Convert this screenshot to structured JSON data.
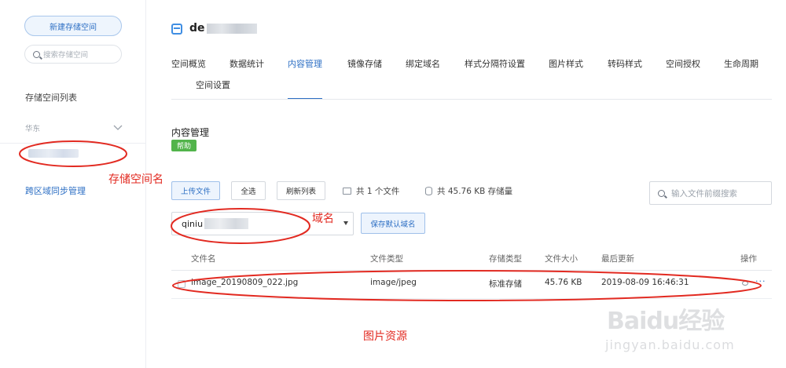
{
  "sidebar": {
    "new_bucket_label": "新建存储空间",
    "search_placeholder": "搜索存储空间",
    "list_title": "存储空间列表",
    "region_label": "华东",
    "sync_link": "跨区域同步管理"
  },
  "header": {
    "bucket_name_visible": "de"
  },
  "tabs": [
    {
      "label": "空间概览"
    },
    {
      "label": "数据统计"
    },
    {
      "label": "内容管理",
      "active": true
    },
    {
      "label": "镜像存储"
    },
    {
      "label": "绑定域名"
    },
    {
      "label": "样式分隔符设置"
    },
    {
      "label": "图片样式"
    },
    {
      "label": "转码样式"
    },
    {
      "label": "空间授权"
    },
    {
      "label": "生命周期"
    },
    {
      "label": "空间设置"
    }
  ],
  "content": {
    "section_title": "内容管理",
    "help_badge": "帮助"
  },
  "toolbar": {
    "upload_label": "上传文件",
    "select_all_label": "全选",
    "refresh_label": "刷新列表",
    "file_count_text": "共 1 个文件",
    "storage_text": "共 45.76 KB 存储量",
    "search_placeholder": "输入文件前缀搜索"
  },
  "domain": {
    "value_visible": "qiniu",
    "save_default_label": "保存默认域名"
  },
  "table": {
    "headers": [
      "文件名",
      "文件类型",
      "存储类型",
      "文件大小",
      "最后更新",
      "操作"
    ],
    "rows": [
      {
        "name": "image_20190809_022.jpg",
        "type": "image/jpeg",
        "storage": "标准存储",
        "size": "45.76 KB",
        "updated": "2019-08-09 16:46:31",
        "more": "···"
      }
    ]
  },
  "annotations": {
    "bucket_name_label": "存储空间名",
    "domain_label": "域名",
    "image_resource_label": "图片资源",
    "color": "#e22a21"
  },
  "watermark": {
    "text": "Baidu经验",
    "sub": "jingyan.baidu.com"
  },
  "colors": {
    "accent": "#2d6fc4",
    "help_green": "#52b44b"
  }
}
